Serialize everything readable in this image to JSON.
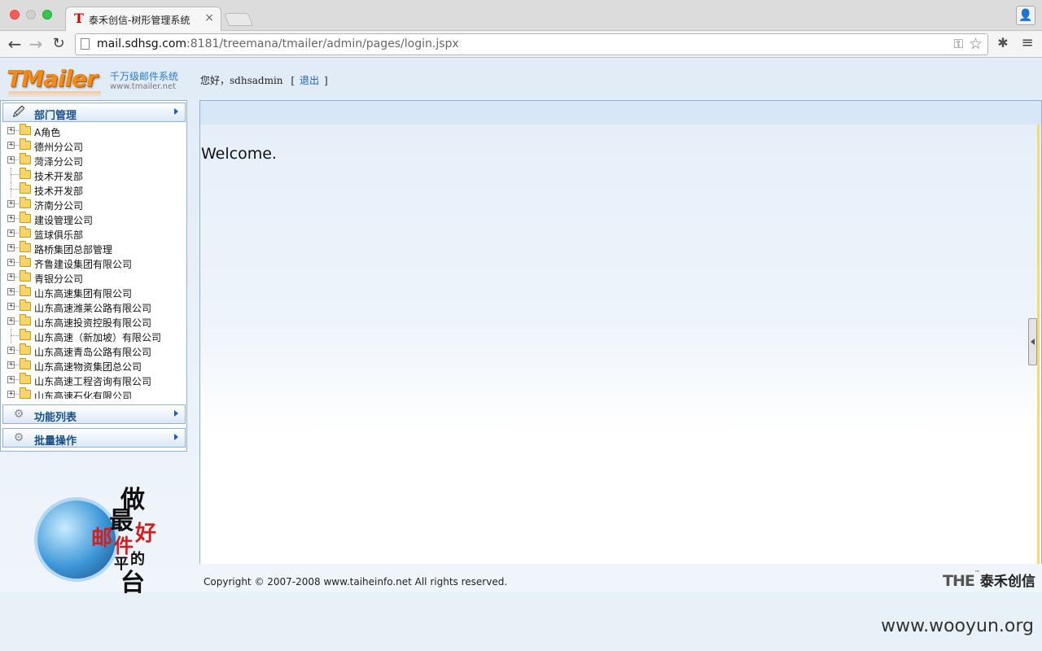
{
  "browser": {
    "tab_title": "泰禾创信-树形管理系统",
    "tab_close": "×",
    "url_host": "mail.sdhsg.com",
    "url_rest": ":8181/treemana/tmailer/admin/pages/login.jspx"
  },
  "header": {
    "logo_text": "TMailer",
    "tagline": "千万级邮件系统",
    "logo_url": "www.tmailer.net",
    "greeting": "您好，sdhsadmin",
    "bracket_open": "[",
    "logout": "退出",
    "bracket_close": "]"
  },
  "sidebar": {
    "dept_title": "部门管理",
    "function_title": "功能列表",
    "batch_title": "批量操作",
    "tree_items": [
      {
        "label": "A角色",
        "expandable": true
      },
      {
        "label": "德州分公司",
        "expandable": true
      },
      {
        "label": "菏泽分公司",
        "expandable": true
      },
      {
        "label": "技术开发部",
        "expandable": false
      },
      {
        "label": "技术开发部",
        "expandable": false
      },
      {
        "label": "济南分公司",
        "expandable": true
      },
      {
        "label": "建设管理公司",
        "expandable": true
      },
      {
        "label": "篮球俱乐部",
        "expandable": true
      },
      {
        "label": "路桥集团总部管理",
        "expandable": true
      },
      {
        "label": "齐鲁建设集团有限公司",
        "expandable": true
      },
      {
        "label": "青银分公司",
        "expandable": true
      },
      {
        "label": "山东高速集团有限公司",
        "expandable": true
      },
      {
        "label": "山东高速潍莱公路有限公司",
        "expandable": true
      },
      {
        "label": "山东高速投资控股有限公司",
        "expandable": true
      },
      {
        "label": "山东高速（新加坡）有限公司",
        "expandable": false
      },
      {
        "label": "山东高速青岛公路有限公司",
        "expandable": true
      },
      {
        "label": "山东高速物资集团总公司",
        "expandable": true
      },
      {
        "label": "山东高速工程咨询有限公司",
        "expandable": true
      },
      {
        "label": "山东高速石化有限公司",
        "expandable": true
      }
    ]
  },
  "promo": {
    "chars": [
      "做",
      "最",
      "好",
      "邮",
      "件",
      "平",
      "的",
      "台"
    ]
  },
  "main": {
    "welcome": "Welcome."
  },
  "footer": {
    "copyright": "Copyright © 2007-2008 www.taiheinfo.net All rights reserved.",
    "company_the": "THE",
    "company_tm": "™",
    "company_name": "泰禾创信"
  },
  "watermark": "www.wooyun.org",
  "icons": {
    "back": "back-arrow-icon",
    "forward": "forward-arrow-icon",
    "reload": "reload-icon",
    "star": "star-icon",
    "menu": "hamburger-menu-icon"
  },
  "colors": {
    "accent": "#1a5fb4",
    "logo_orange": "#f08a1c",
    "panel_border": "#8fb2d6"
  }
}
